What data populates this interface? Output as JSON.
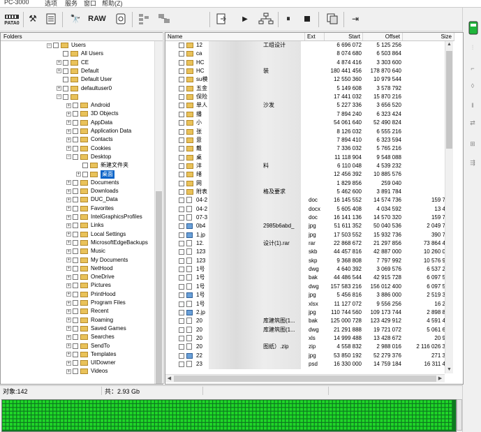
{
  "window": {
    "title": "PC-3000",
    "menu": [
      "选项",
      "服务",
      "窗口",
      "帮助(Z)"
    ]
  },
  "toolbar": {
    "pata_label": "PATA0",
    "raw_label": "RAW"
  },
  "folders_pane": {
    "header": "Folders",
    "tree": [
      {
        "label": "Users",
        "indent": 5,
        "expanded": true
      },
      {
        "label": "All Users",
        "indent": 6
      },
      {
        "label": "CE",
        "indent": 6,
        "collapsed": true
      },
      {
        "label": "Default",
        "indent": 6,
        "collapsed": true
      },
      {
        "label": "Default User",
        "indent": 6
      },
      {
        "label": "defaultuser0",
        "indent": 6,
        "collapsed": true
      },
      {
        "label": "",
        "indent": 6,
        "expanded": true
      },
      {
        "label": "Android",
        "indent": 7,
        "collapsed": true
      },
      {
        "label": "3D Objects",
        "indent": 7,
        "collapsed": true
      },
      {
        "label": "AppData",
        "indent": 7,
        "collapsed": true
      },
      {
        "label": "Application Data",
        "indent": 7,
        "collapsed": true
      },
      {
        "label": "Contacts",
        "indent": 7,
        "collapsed": true
      },
      {
        "label": "Cookies",
        "indent": 7,
        "collapsed": true
      },
      {
        "label": "Desktop",
        "indent": 7,
        "expanded": true
      },
      {
        "label": "新建文件夹",
        "indent": 8
      },
      {
        "label": "桌面",
        "indent": 8,
        "collapsed": true,
        "selected": true
      },
      {
        "label": "Documents",
        "indent": 7,
        "collapsed": true
      },
      {
        "label": "Downloads",
        "indent": 7,
        "collapsed": true
      },
      {
        "label": "DUC_Data",
        "indent": 7,
        "collapsed": true
      },
      {
        "label": "Favorites",
        "indent": 7,
        "collapsed": true
      },
      {
        "label": "IntelGraphicsProfiles",
        "indent": 7,
        "collapsed": true
      },
      {
        "label": "Links",
        "indent": 7,
        "collapsed": true
      },
      {
        "label": "Local Settings",
        "indent": 7,
        "collapsed": true
      },
      {
        "label": "MicrosoftEdgeBackups",
        "indent": 7,
        "collapsed": true
      },
      {
        "label": "Music",
        "indent": 7,
        "collapsed": true
      },
      {
        "label": "My Documents",
        "indent": 7,
        "collapsed": true
      },
      {
        "label": "NetHood",
        "indent": 7,
        "collapsed": true
      },
      {
        "label": "OneDrive",
        "indent": 7,
        "collapsed": true
      },
      {
        "label": "Pictures",
        "indent": 7,
        "collapsed": true
      },
      {
        "label": "PrintHood",
        "indent": 7,
        "collapsed": true
      },
      {
        "label": "Program Files",
        "indent": 7,
        "collapsed": true
      },
      {
        "label": "Recent",
        "indent": 7,
        "collapsed": true
      },
      {
        "label": "Roaming",
        "indent": 7,
        "collapsed": true
      },
      {
        "label": "Saved Games",
        "indent": 7,
        "collapsed": true
      },
      {
        "label": "Searches",
        "indent": 7,
        "collapsed": true
      },
      {
        "label": "SendTo",
        "indent": 7,
        "collapsed": true
      },
      {
        "label": "Templates",
        "indent": 7,
        "collapsed": true
      },
      {
        "label": "UIDowner",
        "indent": 7,
        "collapsed": true
      },
      {
        "label": "Videos",
        "indent": 7,
        "collapsed": true
      }
    ]
  },
  "files_pane": {
    "columns": {
      "name": "Name",
      "ext": "Ext",
      "start": "Start",
      "offset": "Offset",
      "size": "Size"
    },
    "rows": [
      {
        "icon": "folder",
        "name": "12",
        "tail": "工组设计",
        "ext": "",
        "start": "6 696 072",
        "offset": "5 125 256",
        "size": ""
      },
      {
        "icon": "folder",
        "name": "ca",
        "tail": "",
        "ext": "",
        "start": "8 074 680",
        "offset": "6 503 864",
        "size": ""
      },
      {
        "icon": "folder",
        "name": "HC",
        "tail": "",
        "ext": "",
        "start": "4 874 416",
        "offset": "3 303 600",
        "size": ""
      },
      {
        "icon": "folder",
        "name": "HC",
        "tail": "装",
        "ext": "",
        "start": "180 441 456",
        "offset": "178 870 640",
        "size": ""
      },
      {
        "icon": "folder",
        "name": "su模",
        "tail": "",
        "ext": "",
        "start": "12 550 360",
        "offset": "10 979 544",
        "size": ""
      },
      {
        "icon": "folder",
        "name": "五金",
        "tail": "",
        "ext": "",
        "start": "5 149 608",
        "offset": "3 578 792",
        "size": ""
      },
      {
        "icon": "folder",
        "name": "保险",
        "tail": "",
        "ext": "",
        "start": "17 441 032",
        "offset": "15 870 216",
        "size": ""
      },
      {
        "icon": "folder",
        "name": "单人",
        "tail": "沙发",
        "ext": "",
        "start": "5 227 336",
        "offset": "3 656 520",
        "size": ""
      },
      {
        "icon": "folder",
        "name": "播",
        "tail": "",
        "ext": "",
        "start": "7 894 240",
        "offset": "6 323 424",
        "size": ""
      },
      {
        "icon": "folder",
        "name": "小",
        "tail": "",
        "ext": "",
        "start": "54 061 640",
        "offset": "52 490 824",
        "size": ""
      },
      {
        "icon": "folder",
        "name": "张",
        "tail": "",
        "ext": "",
        "start": "8 126 032",
        "offset": "6 555 216",
        "size": ""
      },
      {
        "icon": "folder",
        "name": "意",
        "tail": "",
        "ext": "",
        "start": "7 894 410",
        "offset": "6 323 594",
        "size": ""
      },
      {
        "icon": "folder",
        "name": "戴",
        "tail": "",
        "ext": "",
        "start": "7 336 032",
        "offset": "5 765 216",
        "size": ""
      },
      {
        "icon": "folder",
        "name": "桌",
        "tail": "",
        "ext": "",
        "start": "11 118 904",
        "offset": "9 548 088",
        "size": ""
      },
      {
        "icon": "folder",
        "name": "沣",
        "tail": "料",
        "ext": "",
        "start": "6 110 048",
        "offset": "4 539 232",
        "size": ""
      },
      {
        "icon": "folder",
        "name": "绪",
        "tail": "",
        "ext": "",
        "start": "12 456 392",
        "offset": "10 885 576",
        "size": ""
      },
      {
        "icon": "folder",
        "name": "网",
        "tail": "",
        "ext": "",
        "start": "1 829 856",
        "offset": "259 040",
        "size": ""
      },
      {
        "icon": "folder",
        "name": "附表",
        "tail": "格及要求",
        "ext": "",
        "start": "5 462 600",
        "offset": "3 891 784",
        "size": ""
      },
      {
        "icon": "file",
        "name": "04-2",
        "tail": "",
        "ext": "doc",
        "start": "16 145 552",
        "offset": "14 574 736",
        "size": "159 7"
      },
      {
        "icon": "file",
        "name": "04-2",
        "tail": "",
        "ext": "docx",
        "start": "5 605 408",
        "offset": "4 034 592",
        "size": "13 4"
      },
      {
        "icon": "file",
        "name": "07-3",
        "tail": "",
        "ext": "doc",
        "start": "16 141 136",
        "offset": "14 570 320",
        "size": "159 7"
      },
      {
        "icon": "img",
        "name": "0b4",
        "tail": "2985b6abd_",
        "ext": "jpg",
        "start": "51 611 352",
        "offset": "50 040 536",
        "size": "2 049 7"
      },
      {
        "icon": "img",
        "name": "1.jp",
        "tail": "",
        "ext": "jpg",
        "start": "17 503 552",
        "offset": "15 932 736",
        "size": "390 7"
      },
      {
        "icon": "file",
        "name": "12.",
        "tail": "设计(1).rar",
        "ext": "rar",
        "start": "22 868 672",
        "offset": "21 297 856",
        "size": "73 864 4"
      },
      {
        "icon": "file",
        "name": "123",
        "tail": "",
        "ext": "skb",
        "start": "44 457 816",
        "offset": "42 887 000",
        "size": "10 260 0"
      },
      {
        "icon": "file",
        "name": "123",
        "tail": "",
        "ext": "skp",
        "start": "9 368 808",
        "offset": "7 797 992",
        "size": "10 576 9"
      },
      {
        "icon": "file",
        "name": "1号",
        "tail": "",
        "ext": "dwg",
        "start": "4 640 392",
        "offset": "3 069 576",
        "size": "6 537 2"
      },
      {
        "icon": "file",
        "name": "1号",
        "tail": "",
        "ext": "bak",
        "start": "44 486 544",
        "offset": "42 915 728",
        "size": "6 097 5"
      },
      {
        "icon": "file",
        "name": "1号",
        "tail": "",
        "ext": "dwg",
        "start": "157 583 216",
        "offset": "156 012 400",
        "size": "6 097 5"
      },
      {
        "icon": "img",
        "name": "1号",
        "tail": "",
        "ext": "jpg",
        "start": "5 456 816",
        "offset": "3 886 000",
        "size": "2 519 3"
      },
      {
        "icon": "file",
        "name": "1号",
        "tail": "",
        "ext": "xlsx",
        "start": "11 127 072",
        "offset": "9 556 256",
        "size": "16 2"
      },
      {
        "icon": "img",
        "name": "2.jp",
        "tail": "",
        "ext": "jpg",
        "start": "110 744 560",
        "offset": "109 173 744",
        "size": "2 898 8"
      },
      {
        "icon": "file",
        "name": "20",
        "tail": "库建筑图(1...",
        "ext": "bak",
        "start": "125 000 728",
        "offset": "123 429 912",
        "size": "4 591 4"
      },
      {
        "icon": "file",
        "name": "20",
        "tail": "库建筑图(1...",
        "ext": "dwg",
        "start": "21 291 888",
        "offset": "19 721 072",
        "size": "5 061 6"
      },
      {
        "icon": "file",
        "name": "20",
        "tail": "",
        "ext": "xls",
        "start": "14 999 488",
        "offset": "13 428 672",
        "size": "20 9"
      },
      {
        "icon": "file",
        "name": "20",
        "tail": "图纸）.zip",
        "ext": "zip",
        "start": "4 558 832",
        "offset": "2 988 016",
        "size": "2 116 026 3"
      },
      {
        "icon": "img",
        "name": "22",
        "tail": "",
        "ext": "jpg",
        "start": "53 850 192",
        "offset": "52 279 376",
        "size": "271 3"
      },
      {
        "icon": "file",
        "name": "23",
        "tail": "",
        "ext": "psd",
        "start": "16 330 000",
        "offset": "14 759 184",
        "size": "16 311 4"
      }
    ]
  },
  "status": {
    "objects": "对象:142",
    "total": "共：2.93 Gb"
  },
  "colors": {
    "selection": "#0a64c8",
    "grid_fill": "#1fd628",
    "grid_line": "#0d7a1f",
    "folder": "#e9c25a"
  }
}
